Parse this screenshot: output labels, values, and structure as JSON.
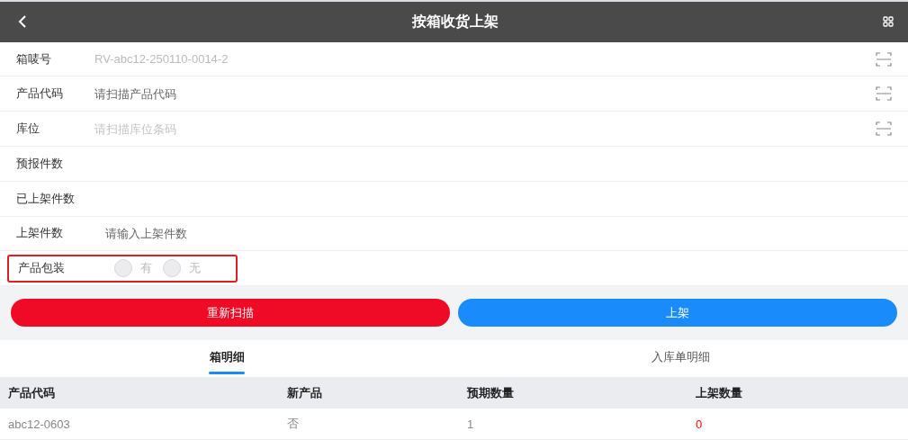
{
  "header": {
    "title": "按箱收货上架"
  },
  "fields": [
    {
      "kind": "scan",
      "label": "箱唛号",
      "value": "RV-abc12-250110-0014-2",
      "disabled": true,
      "focused": false
    },
    {
      "kind": "scan",
      "label": "产品代码",
      "placeholder": "请扫描产品代码",
      "focused": true
    },
    {
      "kind": "scan",
      "label": "库位",
      "placeholder": "请扫描库位条码",
      "focused": false
    },
    {
      "kind": "text",
      "label": "预报件数"
    },
    {
      "kind": "text",
      "label": "已上架件数"
    },
    {
      "kind": "input",
      "label": "上架件数",
      "placeholder": "请输入上架件数",
      "focused": true
    },
    {
      "kind": "radio",
      "label": "产品包装",
      "highlighted": true,
      "options": [
        {
          "label": "有",
          "selected": false,
          "disabled": true
        },
        {
          "label": "无",
          "selected": false,
          "disabled": true
        }
      ]
    }
  ],
  "buttons": [
    {
      "label": "重新扫描",
      "kind": "danger"
    },
    {
      "label": "上架",
      "kind": "primary"
    }
  ],
  "tabs": [
    {
      "label": "箱明细",
      "selected": true
    },
    {
      "label": "入库单明细",
      "selected": false
    }
  ],
  "table": {
    "columns": [
      "产品代码",
      "新产品",
      "预期数量",
      "上架数量"
    ],
    "rows": [
      {
        "cells": [
          {
            "text": "abc12-0603",
            "warning": false
          },
          {
            "text": "否",
            "warning": false
          },
          {
            "text": "1",
            "warning": false
          },
          {
            "text": "0",
            "warning": true
          }
        ]
      }
    ]
  }
}
